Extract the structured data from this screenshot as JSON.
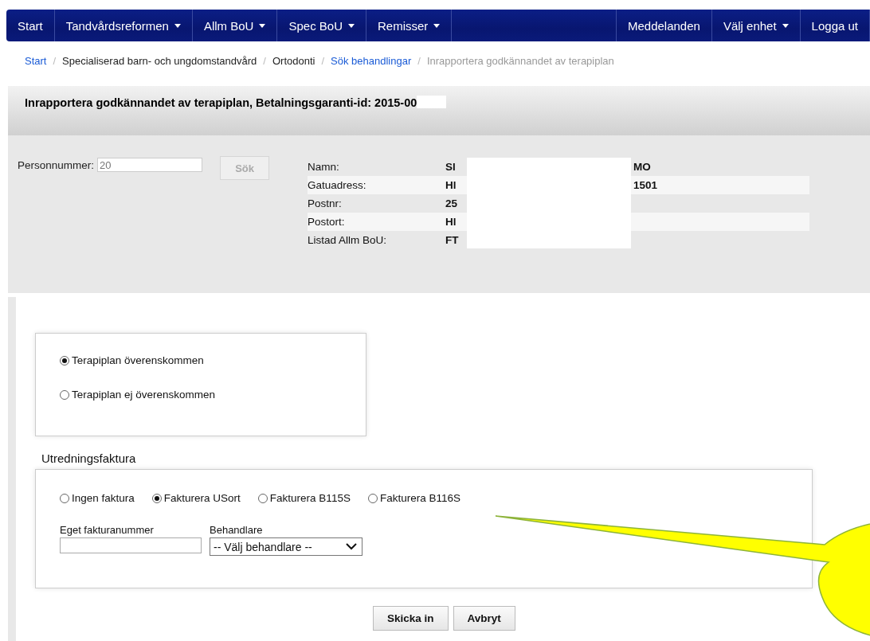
{
  "navbar": {
    "left": [
      {
        "label": "Start",
        "dropdown": false
      },
      {
        "label": "Tandvårdsreformen",
        "dropdown": true
      },
      {
        "label": "Allm BoU",
        "dropdown": true
      },
      {
        "label": "Spec BoU",
        "dropdown": true
      },
      {
        "label": "Remisser",
        "dropdown": true
      }
    ],
    "right": [
      {
        "label": "Meddelanden",
        "dropdown": false
      },
      {
        "label": "Välj enhet",
        "dropdown": true
      },
      {
        "label": "Logga ut",
        "dropdown": false
      }
    ]
  },
  "breadcrumb_separator": "/",
  "breadcrumb": [
    {
      "label": "Start",
      "kind": "link"
    },
    {
      "label": "Specialiserad barn- och ungdomstandvård",
      "kind": "text"
    },
    {
      "label": "Ortodonti",
      "kind": "text"
    },
    {
      "label": "Sök behandlingar",
      "kind": "link"
    },
    {
      "label": "Inrapportera godkännandet av terapiplan",
      "kind": "current"
    }
  ],
  "panel_title": "Inrapportera godkännandet av terapiplan, Betalningsgaranti-id: 2015-00",
  "search": {
    "label": "Personnummer:",
    "value": "20",
    "button": "Sök"
  },
  "patient": [
    {
      "label": "Namn:",
      "value": "Sl",
      "value_end": "MO"
    },
    {
      "label": "Gatuadress:",
      "value": "Hl",
      "value_end": "1501"
    },
    {
      "label": "Postnr:",
      "value": "25"
    },
    {
      "label": "Postort:",
      "value": "Hl"
    },
    {
      "label": "Listad Allm BoU:",
      "value": "FT"
    }
  ],
  "plan_options": [
    {
      "label": "Terapiplan överenskommen",
      "selected": true
    },
    {
      "label": "Terapiplan ej överenskommen",
      "selected": false
    }
  ],
  "invoice_heading": "Utredningsfaktura",
  "invoice_options": [
    {
      "label": "Ingen faktura",
      "selected": false
    },
    {
      "label": "Fakturera USort",
      "selected": true
    },
    {
      "label": "Fakturera B115S",
      "selected": false
    },
    {
      "label": "Fakturera B116S",
      "selected": false
    }
  ],
  "invoice_number": {
    "label": "Eget fakturanummer"
  },
  "practitioner": {
    "label": "Behandlare",
    "value": "-- Välj behandlare --"
  },
  "buttons": [
    "Skicka in",
    "Avbryt"
  ]
}
